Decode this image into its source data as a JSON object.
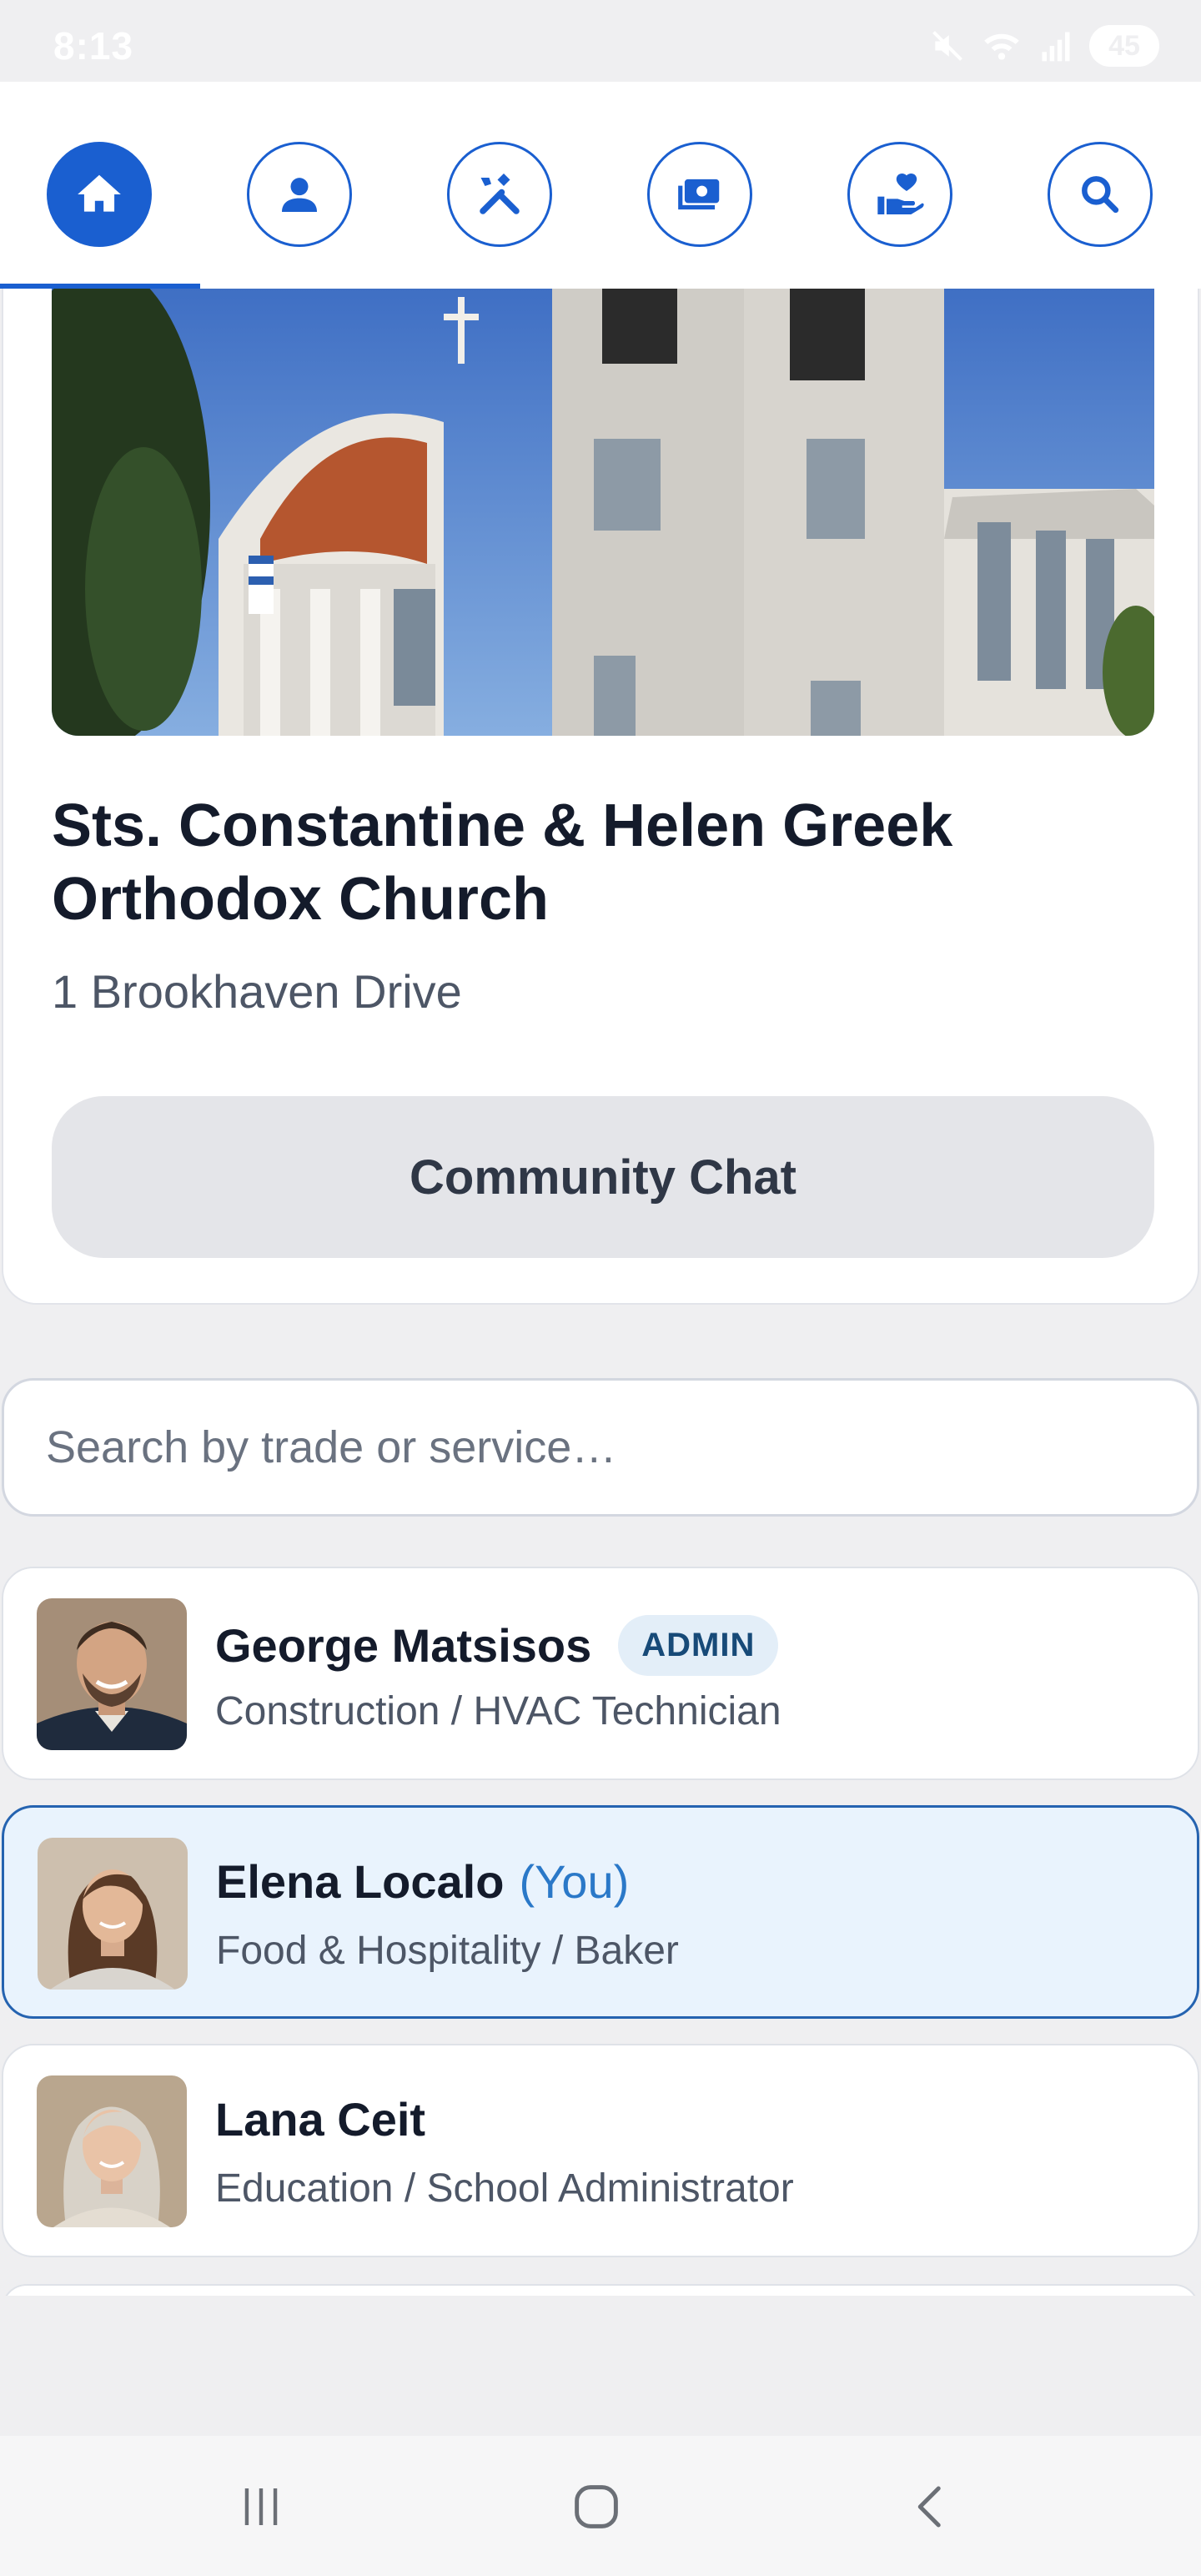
{
  "status_bar": {
    "time": "8:13",
    "battery": "45"
  },
  "nav": {
    "items": [
      {
        "icon": "home-icon",
        "label": "Home",
        "active": true
      },
      {
        "icon": "person-icon",
        "label": "Profile",
        "active": false
      },
      {
        "icon": "tools-icon",
        "label": "Services",
        "active": false
      },
      {
        "icon": "money-icon",
        "label": "Payments",
        "active": false
      },
      {
        "icon": "charity-icon",
        "label": "Donations",
        "active": false
      },
      {
        "icon": "search-icon",
        "label": "Search",
        "active": false
      }
    ]
  },
  "church": {
    "name": "Sts. Constantine & Helen Greek Orthodox Church",
    "address": "1 Brookhaven Drive",
    "chat_button": "Community Chat"
  },
  "search": {
    "placeholder": "Search by trade or service…",
    "value": ""
  },
  "members": [
    {
      "name": "George Matsisos",
      "badge": "ADMIN",
      "role": "Construction / HVAC Technician",
      "is_you": false
    },
    {
      "name": "Elena Localo",
      "you_tag": "(You)",
      "role": "Food & Hospitality / Baker",
      "is_you": true
    },
    {
      "name": "Lana Ceit",
      "role": "Education / School Administrator",
      "is_you": false
    }
  ],
  "colors": {
    "accent": "#1a5fd0",
    "you_highlight": "#e9f3fd",
    "you_border": "#2563b0",
    "background": "#efeff1"
  }
}
